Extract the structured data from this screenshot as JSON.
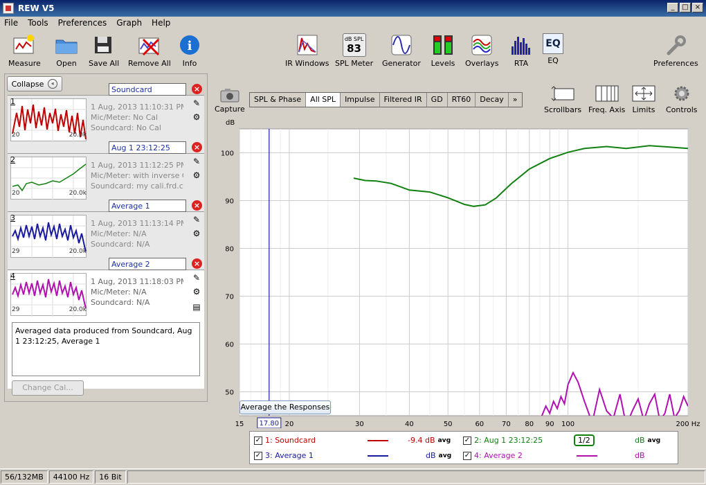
{
  "window": {
    "title": "REW V5"
  },
  "menu": [
    "File",
    "Tools",
    "Preferences",
    "Graph",
    "Help"
  ],
  "toolbar": {
    "left": [
      {
        "label": "Measure",
        "icon": "measure-icon"
      },
      {
        "label": "Open",
        "icon": "folder-icon"
      },
      {
        "label": "Save All",
        "icon": "save-icon"
      },
      {
        "label": "Remove All",
        "icon": "remove-all-icon"
      },
      {
        "label": "Info",
        "icon": "info-icon"
      }
    ],
    "center": [
      {
        "label": "IR Windows",
        "icon": "ir-windows-icon"
      },
      {
        "label": "SPL Meter",
        "icon": "spl-meter-icon",
        "badge_top": "dB SPL",
        "badge_value": "83"
      },
      {
        "label": "Generator",
        "icon": "generator-icon"
      },
      {
        "label": "Levels",
        "icon": "levels-icon"
      },
      {
        "label": "Overlays",
        "icon": "overlays-icon"
      },
      {
        "label": "RTA",
        "icon": "rta-icon"
      },
      {
        "label": "EQ",
        "icon": "eq-icon",
        "badge_value": "EQ"
      }
    ],
    "right": {
      "label": "Preferences",
      "icon": "wrench-icon"
    }
  },
  "panel": {
    "collapse_label": "Collapse",
    "change_cal_label": "Change Cal...",
    "notes": "Averaged data produced from Soundcard, Aug 1 23:12:25, Average 1"
  },
  "measurements": [
    {
      "num": "1",
      "name": "Soundcard",
      "date": "1 Aug, 2013 11:10:31 PM",
      "mic": "Mic/Meter: No Cal",
      "soundcard": "Soundcard: No Cal",
      "xmin": "20",
      "xmax": "20.0k",
      "color": "#c00000"
    },
    {
      "num": "2",
      "name": "Aug 1 23:12:25",
      "date": "1 Aug, 2013 11:12:25 PM",
      "mic": "Mic/Meter: with inverse C",
      "soundcard": "Soundcard: my cali.frd.cal",
      "xmin": "20",
      "xmax": "20.0k",
      "color": "#108010"
    },
    {
      "num": "3",
      "name": "Average 1",
      "date": "1 Aug, 2013 11:13:14 PM",
      "mic": "Mic/Meter: N/A",
      "soundcard": "Soundcard: N/A",
      "xmin": "29",
      "xmax": "20.0k",
      "color": "#1a1aa0"
    },
    {
      "num": "4",
      "name": "Average 2",
      "date": "1 Aug, 2013 11:18:03 PM",
      "mic": "Mic/Meter: N/A",
      "soundcard": "Soundcard: N/A",
      "xmin": "29",
      "xmax": "20.0k",
      "color": "#b010b0"
    }
  ],
  "graph": {
    "capture_label": "Capture",
    "tabs": [
      "SPL & Phase",
      "All SPL",
      "Impulse",
      "Filtered IR",
      "GD",
      "RT60",
      "Decay",
      "»"
    ],
    "selected_tab": "All SPL",
    "controls": [
      {
        "label": "Scrollbars",
        "icon": "scrollbars-icon"
      },
      {
        "label": "Freq. Axis",
        "icon": "freq-axis-icon"
      },
      {
        "label": "Limits",
        "icon": "limits-icon"
      },
      {
        "label": "Controls",
        "icon": "gear-icon"
      }
    ],
    "avg_button": "Average the Responses",
    "cursor_value": "17.80"
  },
  "chart_data": {
    "type": "line",
    "ylabel": "dB",
    "xlabel": "Hz",
    "x_scale": "log",
    "xlim": [
      15,
      200
    ],
    "ylim": [
      45,
      105
    ],
    "x_ticks": [
      {
        "v": 15,
        "label": "15"
      },
      {
        "v": 20,
        "label": "20"
      },
      {
        "v": 30,
        "label": "30"
      },
      {
        "v": 40,
        "label": "40"
      },
      {
        "v": 50,
        "label": "50"
      },
      {
        "v": 60,
        "label": "60"
      },
      {
        "v": 70,
        "label": "70"
      },
      {
        "v": 80,
        "label": "80"
      },
      {
        "v": 90,
        "label": "90"
      },
      {
        "v": 100,
        "label": "100"
      },
      {
        "v": 200,
        "label": "200 Hz"
      }
    ],
    "y_ticks": [
      50,
      60,
      70,
      80,
      90,
      100
    ],
    "cursor_x": 17.8,
    "series": [
      {
        "name": "2: Aug 1 23:12:25",
        "color": "#108010",
        "x": [
          29,
          31,
          33,
          36,
          40,
          45,
          50,
          55,
          58,
          62,
          66,
          72,
          80,
          90,
          100,
          110,
          125,
          140,
          160,
          180,
          200
        ],
        "y": [
          94.7,
          94.2,
          94.1,
          93.6,
          92.2,
          91.8,
          90.6,
          89.2,
          88.8,
          89.1,
          90.5,
          93.5,
          96.6,
          98.8,
          100.1,
          100.9,
          101.3,
          100.9,
          101.5,
          101.2,
          100.9
        ]
      },
      {
        "name": "4: Average 2",
        "color": "#b010b0",
        "x": [
          86,
          88,
          90,
          92,
          94,
          96,
          98,
          100,
          103,
          106,
          110,
          115,
          120,
          125,
          130,
          135,
          140,
          145,
          150,
          155,
          160,
          165,
          170,
          175,
          180,
          185,
          190,
          195,
          200
        ],
        "y": [
          45,
          47,
          45.5,
          48,
          46.5,
          49,
          47.5,
          51.5,
          54,
          52,
          48,
          43.5,
          50.5,
          46,
          44.5,
          49.5,
          43,
          46,
          48.5,
          44,
          47.5,
          49.5,
          44,
          45.5,
          49.5,
          44.5,
          46,
          49,
          47
        ]
      }
    ]
  },
  "legend": [
    {
      "label": "1: Soundcard",
      "color": "#c00000",
      "value": "-9.4 dB",
      "suffix": "avg"
    },
    {
      "label": "2: Aug 1 23:12:25",
      "color": "#108010",
      "value": "dB",
      "suffix": "avg",
      "smoothing": "1/2"
    },
    {
      "label": "3: Average 1",
      "color": "#1a1aa0",
      "value": "dB",
      "suffix": "avg"
    },
    {
      "label": "4: Average 2",
      "color": "#b010b0",
      "value": "dB",
      "suffix": ""
    }
  ],
  "status": {
    "memory": "56/132MB",
    "rate": "44100 Hz",
    "bits": "16 Bit"
  }
}
